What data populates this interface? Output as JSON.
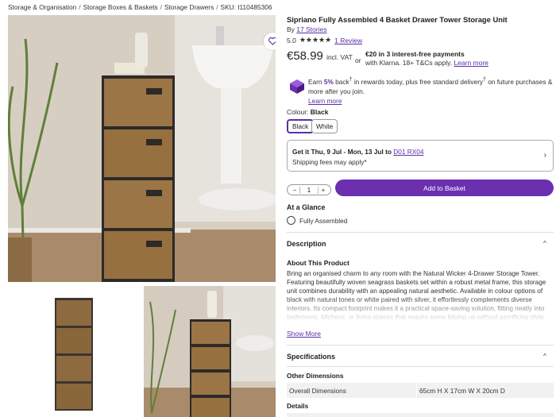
{
  "breadcrumb": {
    "items": [
      "Storage & Organisation",
      "Storage Boxes & Baskets",
      "Storage Drawers"
    ],
    "separator": "/",
    "sku": "SKU: I110485306"
  },
  "product": {
    "title": "Sipriano Fully Assembled 4 Basket Drawer Tower Storage Unit",
    "by_prefix": "By",
    "brand_link": "17 Stories",
    "rating_value": "5.0",
    "stars": "★★★★★",
    "review_link": "1 Review",
    "price": "€58.99",
    "price_suffix": "incl. VAT",
    "or_text": "or",
    "klarna_line1": "€20 in 3 interest-free payments",
    "klarna_line2_prefix": "with Klarna. 18+ T&Cs apply.",
    "klarna_learn_more": "Learn more"
  },
  "rewards": {
    "prefix": "Earn",
    "percent": "5%",
    "middle": "back",
    "sup1": "†",
    "text2": "in rewards today, plus free standard delivery",
    "sup2": "†",
    "text3": "on future purchases & more after you join.",
    "learn_more": "Learn more"
  },
  "colour": {
    "label": "Colour:",
    "selected": "Black",
    "options": [
      "Black",
      "White"
    ]
  },
  "delivery": {
    "line1_prefix": "Get it Thu, 9 Jul - Mon, 13 Jul to",
    "postcode": "D01 RX04",
    "line2": "Shipping fees may apply*",
    "chevron": "›"
  },
  "cart": {
    "minus": "−",
    "quantity": "1",
    "plus": "+",
    "add_label": "Add to Basket"
  },
  "glance": {
    "heading": "At a Glance",
    "item": "Fully Assembled"
  },
  "description": {
    "heading": "Description",
    "caret": "^",
    "about_heading": "About This Product",
    "about_text": "Bring an organised charm to any room with the Natural Wicker 4-Drawer Storage Tower. Featuring beautifully woven seagrass baskets set within a robust metal frame, this storage unit combines durability with an appealing natural aesthetic. Available in colour options of black with natural tones or white paired with silver, it effortlessly complements diverse interiors. Its compact footprint makes it a practical space-saving solution, fitting neatly into bathrooms, kitchens, or living spaces that require some tidying up without sacrificing style.",
    "show_more": "Show More"
  },
  "specifications": {
    "heading": "Specifications",
    "caret": "^",
    "other_dimensions": "Other Dimensions",
    "rows": [
      {
        "key": "Overall Dimensions",
        "value": "65cm H X 17cm W X 20cm D"
      }
    ],
    "details_heading": "Details"
  }
}
